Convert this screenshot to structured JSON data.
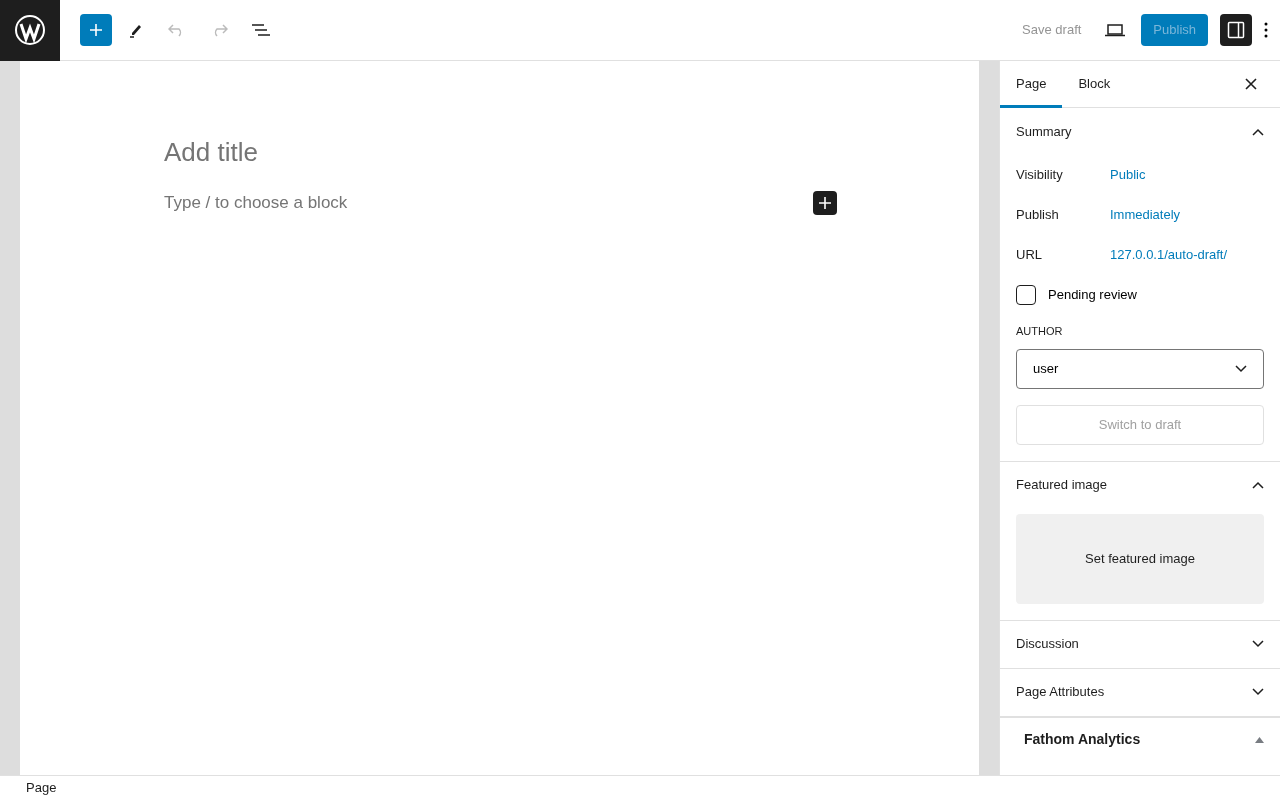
{
  "toolbar": {
    "save_draft": "Save draft",
    "publish": "Publish",
    "settings_open": true
  },
  "editor": {
    "title_placeholder": "Add title",
    "block_placeholder": "Type / to choose a block"
  },
  "sidebar": {
    "tabs": [
      {
        "label": "Page",
        "selected": true
      },
      {
        "label": "Block",
        "selected": false
      }
    ],
    "summary": {
      "title": "Summary",
      "expanded": true,
      "rows": [
        {
          "label": "Visibility",
          "value": "Public"
        },
        {
          "label": "Publish",
          "value": "Immediately"
        },
        {
          "label": "URL",
          "value": "127.0.0.1/auto-draft/"
        }
      ],
      "pending": {
        "label": "Pending review",
        "checked": false
      },
      "author_label": "AUTHOR",
      "author": "user",
      "switch": "Switch to draft"
    },
    "featured": {
      "title": "Featured image",
      "expanded": true,
      "button": "Set featured image"
    },
    "panels": [
      {
        "title": "Discussion",
        "expanded": false
      },
      {
        "title": "Page Attributes",
        "expanded": false
      }
    ],
    "metabox": {
      "title": "Fathom Analytics",
      "expanded": true
    }
  },
  "status_bar": "Page"
}
